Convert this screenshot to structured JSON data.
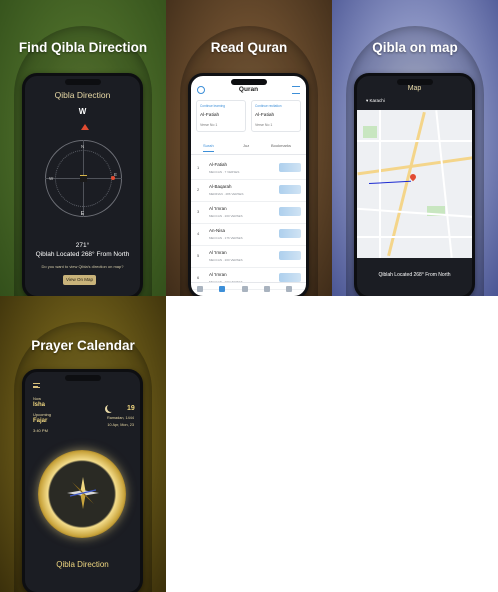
{
  "panels": {
    "qibla": {
      "headline": "Find Qibla Direction",
      "screen_title": "Qibla Direction",
      "top_letter": "W",
      "dial_north": "N",
      "dial_west": "W",
      "dial_east": "E",
      "bottom_letter": "E",
      "degrees": "271°",
      "location_text": "Qiblah Located 268° From North",
      "map_prompt": "Do you want to view Qibla's direction on map?",
      "view_button": "View On Map"
    },
    "quran": {
      "headline": "Read Quran",
      "screen_title": "Quran",
      "continue_learning": {
        "label": "Continue learning",
        "surah": "Al-Fatiah",
        "verse": "Verse No 1"
      },
      "continue_recitation": {
        "label": "Continue recitation",
        "surah": "Al-Fatiah",
        "verse": "Verse No 1"
      },
      "tabs": [
        "Surah",
        "Juz",
        "Bookmarks"
      ],
      "surahs": [
        {
          "num": "1",
          "name": "Al-Fatiah",
          "meta": "MECCAN · 7 VERSES"
        },
        {
          "num": "2",
          "name": "Al-Baqarah",
          "meta": "MEDINAN · 286 VERSES"
        },
        {
          "num": "3",
          "name": "Al 'Imran",
          "meta": "MECCAN · 200 VERSES"
        },
        {
          "num": "4",
          "name": "An-Nisa",
          "meta": "MECCAN · 176 VERSES"
        },
        {
          "num": "5",
          "name": "Al 'Imran",
          "meta": "MECCAN · 200 VERSES"
        },
        {
          "num": "6",
          "name": "Al 'Imran",
          "meta": "MECCAN · 200 VERSES"
        }
      ]
    },
    "map": {
      "headline": "Qibla on map",
      "screen_title": "Map",
      "location": "Karachi",
      "qibla_text": "Qiblah Located 268° From North"
    },
    "prayer": {
      "headline": "Prayer Calendar",
      "now_label": "Now",
      "now_prayer": "Isha",
      "upcoming_label": "Upcoming",
      "upcoming_prayer": "Fajar",
      "upcoming_time": "3:40 PM",
      "day": "19",
      "hijri_date": "Ramadan, 1444",
      "greg_date": "10 Apr, Mon, 23",
      "footer": "Qibla Direction"
    }
  },
  "colors": {
    "gold": "#f0d780",
    "accent_blue": "#3d8fd8",
    "qibla_red": "#e24b31",
    "qibla_line": "#1b2ad1",
    "phone_dark": "#1b1d23"
  },
  "icons": [
    "search-icon",
    "filter-icon",
    "home-icon",
    "book-icon",
    "bag-icon",
    "bulb-icon",
    "gear-icon",
    "menu-icon",
    "moon-icon",
    "map-pin-icon",
    "compass-icon",
    "kaaba-icon"
  ]
}
